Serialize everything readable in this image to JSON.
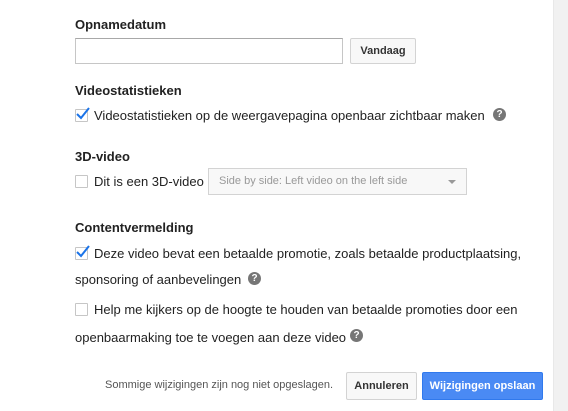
{
  "recording_date": {
    "title": "Opnamedatum",
    "input_value": "",
    "input_placeholder": "",
    "today_button": "Vandaag"
  },
  "video_stats": {
    "title": "Videostatistieken",
    "checkbox_label": "Videostatistieken op de weergavepagina openbaar zichtbaar maken",
    "checked": true,
    "help_icon": "question-circle-icon"
  },
  "video_3d": {
    "title": "3D-video",
    "checkbox_label": "Dit is een 3D-video",
    "checked": false,
    "select_value": "Side by side: Left video on the left side"
  },
  "content_declaration": {
    "title": "Contentvermelding",
    "paid_promotion": {
      "label_line1": "Deze video bevat een betaalde promotie, zoals betaalde productplaatsing,",
      "label_line2": "sponsoring of aanbevelingen",
      "checked": true,
      "help_icon": "question-circle-icon"
    },
    "disclosure": {
      "label_line1": "Help me kijkers op de hoogte te houden van betaalde promoties door een",
      "label_line2": "openbaarmaking toe te voegen aan deze video",
      "checked": false,
      "help_icon": "question-circle-icon"
    }
  },
  "footer": {
    "status_text": "Sommige wijzigingen zijn nog niet opgeslagen.",
    "cancel_button": "Annuleren",
    "save_button": "Wijzigingen opslaan"
  },
  "colors": {
    "accent": "#4a8af4",
    "checkmark": "#1a73e8",
    "help_icon": "#767676"
  }
}
